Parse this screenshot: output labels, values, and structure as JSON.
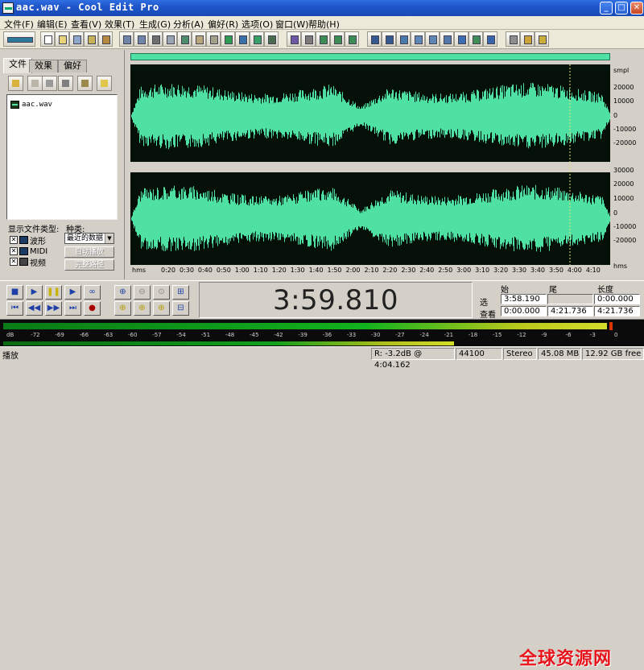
{
  "window": {
    "title": "aac.wav - Cool Edit Pro",
    "minimize": "_",
    "maximize": "□",
    "close": "✕"
  },
  "menu": [
    "文件(F)",
    "编辑(E)",
    "查看(V)",
    "效果(T)",
    "生成(G)",
    "分析(A)",
    "偏好(R)",
    "选项(O)",
    "窗口(W)",
    "帮助(H)"
  ],
  "left_panel": {
    "tabs": [
      "文件",
      "效果",
      "偏好"
    ],
    "files": [
      "aac.wav"
    ],
    "show_types_label": "显示文件类型:",
    "sort_label": "种类:",
    "types": [
      {
        "label": "波形",
        "checked": true
      },
      {
        "label": "MIDI",
        "checked": true
      },
      {
        "label": "视频",
        "checked": true
      }
    ],
    "sort_value": "最近的数据",
    "auto_play": "自动播放",
    "full_path": "完整路径"
  },
  "waveform": {
    "ruler_units": "smpl",
    "channel1_labels": [
      "20000",
      "10000",
      "0",
      "-10000",
      "-20000"
    ],
    "channel2_labels": [
      "30000",
      "20000",
      "10000",
      "0",
      "-10000",
      "-20000"
    ],
    "time_unit_left": "hms",
    "time_unit_right": "hms",
    "time_ticks": [
      "0:20",
      "0:30",
      "0:40",
      "0:50",
      "1:00",
      "1:10",
      "1:20",
      "1:30",
      "1:40",
      "1:50",
      "2:00",
      "2:10",
      "2:20",
      "2:30",
      "2:40",
      "2:50",
      "3:00",
      "3:10",
      "3:20",
      "3:30",
      "3:40",
      "3:50",
      "4:00",
      "4:10"
    ],
    "wave_color": "#4fe0a4"
  },
  "transport": {
    "time": "3:59.810"
  },
  "selection": {
    "col_begin": "始",
    "col_end": "尾",
    "col_length": "长度",
    "row_select": "选",
    "row_view": "查看",
    "select_begin": "3:58.190",
    "select_end": "",
    "select_length": "0:00.000",
    "view_begin": "0:00.000",
    "view_end": "4:21.736",
    "view_length": "4:21.736"
  },
  "meter": {
    "ticks": [
      "dB",
      "-72",
      "-69",
      "-66",
      "-63",
      "-60",
      "-57",
      "-54",
      "-51",
      "-48",
      "-45",
      "-42",
      "-39",
      "-36",
      "-33",
      "-30",
      "-27",
      "-24",
      "-21",
      "-18",
      "-15",
      "-12",
      "-9",
      "-6",
      "-3",
      "0"
    ],
    "watermark": "全球资源网"
  },
  "status": {
    "mode": "播放",
    "level": "R: -3.2dB @ 4:04.162",
    "sample_rate": "44100",
    "channels": "Stereo",
    "file_size": "45.08 MB",
    "free_space": "12.92 GB free"
  }
}
